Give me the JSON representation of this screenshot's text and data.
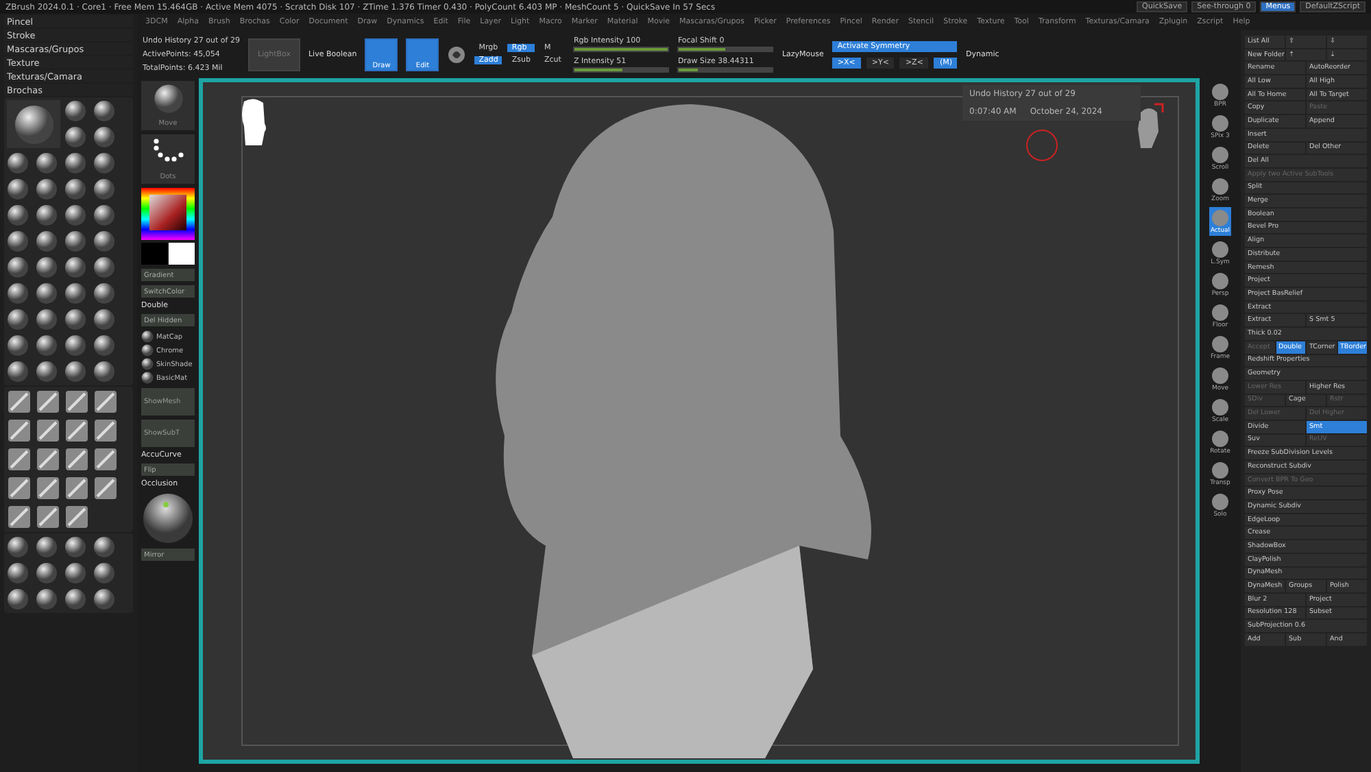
{
  "title_bar": {
    "text": "ZBrush 2024.0.1 · Core1 · Free Mem 15.464GB · Active Mem 4075 · Scratch Disk 107 · ZTime 1.376 Timer 0.430 · PolyCount 6.403 MP · MeshCount 5 · QuickSave In 57 Secs",
    "buttons": [
      {
        "label": "QuickSave",
        "selected": false
      },
      {
        "label": "See-through 0",
        "selected": false
      },
      {
        "label": "Menus",
        "selected": true
      },
      {
        "label": "DefaultZScript",
        "selected": false
      }
    ]
  },
  "palettes": [
    {
      "label": "Pincel"
    },
    {
      "label": "Stroke"
    },
    {
      "label": "Mascaras/Grupos"
    },
    {
      "label": "Texture"
    },
    {
      "label": "Texturas/Camara"
    },
    {
      "label": "Brochas"
    }
  ],
  "menu_bar": [
    "3DCM",
    "Alpha",
    "Brush",
    "Brochas",
    "Color",
    "Document",
    "Draw",
    "Dynamics",
    "Edit",
    "File",
    "Layer",
    "Light",
    "Macro",
    "Marker",
    "Material",
    "Movie",
    "Mascaras/Grupos",
    "Picker",
    "Preferences",
    "Pincel",
    "Render",
    "Stencil",
    "Stroke",
    "Texture",
    "Tool",
    "Transform",
    "Texturas/Camara",
    "Zplugin",
    "Zscript",
    "Help"
  ],
  "shelf": {
    "undo": "Undo History 27 out of 29",
    "active_points": "ActivePoints: 45,054",
    "total_points": "TotalPoints: 6.423 Mil",
    "toggles": [
      {
        "label": "LightBox",
        "selected": false
      },
      {
        "label": "Live Boolean",
        "selected": false
      }
    ],
    "tools": [
      {
        "label": "Draw",
        "selected": true
      },
      {
        "label": "Edit",
        "selected": true
      }
    ],
    "modes": [
      {
        "label": "Mrgb",
        "selected": false
      },
      {
        "label": "Rgb",
        "selected": true
      },
      {
        "label": "M",
        "selected": false
      },
      {
        "label": "Zadd",
        "selected": true
      },
      {
        "label": "Zsub",
        "selected": false
      },
      {
        "label": "Zcut",
        "selected": false
      }
    ],
    "sliders": [
      {
        "label": "Rgb Intensity 100",
        "level": 1
      },
      {
        "label": "Z Intensity 51",
        "level": 0.51
      },
      {
        "label": "Focal Shift 0",
        "level": 0.5
      },
      {
        "label": "Draw Size 38.44311",
        "level": 0.2
      }
    ],
    "lazymouse": "LazyMouse",
    "symmetry": {
      "label": "Activate Symmetry",
      "selected": true
    },
    "axes": [
      {
        "label": ">X<",
        "selected": true
      },
      {
        "label": ">Y<",
        "selected": false
      },
      {
        "label": ">Z<",
        "selected": false
      },
      {
        "label": "(M)",
        "selected": true
      }
    ],
    "dynamic": "Dynamic"
  },
  "side_column": [
    {
      "kind": "thumb",
      "label": "Move"
    },
    {
      "kind": "stroke",
      "label": "Dots"
    },
    {
      "kind": "colorpicker"
    },
    {
      "kind": "button",
      "label": "Gradient"
    },
    {
      "kind": "button",
      "label": "SwitchColor"
    },
    {
      "kind": "label",
      "label": "Double"
    },
    {
      "kind": "button",
      "label": "Del Hidden"
    },
    {
      "kind": "materials",
      "labels": [
        "MatCap",
        "Chrome",
        "SkinShade",
        "BasicMat"
      ]
    },
    {
      "kind": "tall",
      "label": "ShowMesh"
    },
    {
      "kind": "tall",
      "label": "ShowSubT"
    },
    {
      "kind": "label",
      "label": "AccuCurve"
    },
    {
      "kind": "button",
      "label": "Flip"
    },
    {
      "kind": "label",
      "label": "Occlusion"
    },
    {
      "kind": "sphere"
    },
    {
      "kind": "button",
      "label": "Mirror"
    }
  ],
  "viewport": {
    "tooltip": {
      "title": "Undo History 27 out of 29",
      "time": "0:07:40 AM",
      "date": "October 24, 2024"
    }
  },
  "right_shelf": [
    {
      "label": "BPR",
      "selected": false
    },
    {
      "label": "SPix 3",
      "selected": false
    },
    {
      "label": "Scroll",
      "selected": false
    },
    {
      "label": "Zoom",
      "selected": false
    },
    {
      "label": "Actual",
      "selected": true
    },
    {
      "label": "L.Sym",
      "selected": false
    },
    {
      "label": "Persp",
      "selected": false
    },
    {
      "label": "Floor",
      "selected": false
    },
    {
      "label": "Frame",
      "selected": false
    },
    {
      "label": "Move",
      "selected": false
    },
    {
      "label": "Scale",
      "selected": false
    },
    {
      "label": "Rotate",
      "selected": false
    },
    {
      "label": "Transp",
      "selected": false
    },
    {
      "label": "Solo",
      "selected": false
    }
  ],
  "right_panel": [
    [
      {
        "label": "List All",
        "selected": false,
        "disabled": false
      },
      {
        "label": "⇧",
        "selected": false,
        "disabled": false
      },
      {
        "label": "⇩",
        "selected": false,
        "disabled": false
      }
    ],
    [
      {
        "label": "New Folder",
        "selected": false,
        "disabled": false
      },
      {
        "label": "⇡",
        "selected": false,
        "disabled": false
      },
      {
        "label": "⇣",
        "selected": false,
        "disabled": false
      }
    ],
    [
      {
        "label": "Rename",
        "selected": false,
        "disabled": false
      },
      {
        "label": "AutoReorder",
        "selected": false,
        "disabled": false
      }
    ],
    [
      {
        "label": "All Low",
        "selected": false,
        "disabled": false
      },
      {
        "label": "All High",
        "selected": false,
        "disabled": false
      }
    ],
    [
      {
        "label": "All To Home",
        "selected": false,
        "disabled": false
      },
      {
        "label": "All To Target",
        "selected": false,
        "disabled": false
      }
    ],
    [
      {
        "label": "Copy",
        "selected": false,
        "disabled": false
      },
      {
        "label": "Paste",
        "selected": false,
        "disabled": true
      }
    ],
    [
      {
        "label": "Duplicate",
        "selected": false,
        "disabled": false
      },
      {
        "label": "Append",
        "selected": false,
        "disabled": false
      }
    ],
    [
      {
        "label": "Insert",
        "selected": false,
        "disabled": false
      }
    ],
    [
      {
        "label": "Delete",
        "selected": false,
        "disabled": false
      },
      {
        "label": "Del Other",
        "selected": false,
        "disabled": false
      }
    ],
    [
      {
        "label": "Del All",
        "selected": false,
        "disabled": false
      }
    ],
    [
      {
        "label": "Apply two Active SubTools",
        "selected": false,
        "disabled": true
      }
    ],
    [
      {
        "label": "Split",
        "selected": false,
        "disabled": false
      }
    ],
    [
      {
        "label": "Merge",
        "selected": false,
        "disabled": false
      }
    ],
    [
      {
        "label": "Boolean",
        "selected": false,
        "disabled": false
      }
    ],
    [
      {
        "label": "Bevel Pro",
        "selected": false,
        "disabled": false
      }
    ],
    [
      {
        "label": "Align",
        "selected": false,
        "disabled": false
      }
    ],
    [
      {
        "label": "Distribute",
        "selected": false,
        "disabled": false
      }
    ],
    [
      {
        "label": "Remesh",
        "selected": false,
        "disabled": false
      }
    ],
    [
      {
        "label": "Project",
        "selected": false,
        "disabled": false
      }
    ],
    [
      {
        "label": "Project BasRelief",
        "selected": false,
        "disabled": false
      }
    ],
    [
      {
        "label": "Extract",
        "selected": false,
        "disabled": false
      }
    ],
    [
      {
        "label": "Extract",
        "selected": false,
        "disabled": false
      },
      {
        "label": "S Smt 5",
        "selected": false,
        "disabled": false
      }
    ],
    [
      {
        "label": "Thick 0.02",
        "selected": false,
        "disabled": false
      }
    ],
    [
      {
        "label": "Accept",
        "selected": false,
        "disabled": true
      },
      {
        "label": "Double",
        "selected": true,
        "disabled": false
      },
      {
        "label": "TCorner",
        "selected": false,
        "disabled": false
      },
      {
        "label": "TBorder",
        "selected": true,
        "disabled": false
      }
    ],
    [
      {
        "label": "Redshift Properties",
        "selected": false,
        "disabled": false
      }
    ],
    [
      {
        "label": "Geometry",
        "selected": false,
        "disabled": false
      }
    ],
    [
      {
        "label": "Lower Res",
        "selected": false,
        "disabled": true
      },
      {
        "label": "Higher Res",
        "selected": false,
        "disabled": false
      }
    ],
    [
      {
        "label": "SDiv",
        "selected": false,
        "disabled": true
      },
      {
        "label": "Cage",
        "selected": false,
        "disabled": false
      },
      {
        "label": "Rstr",
        "selected": false,
        "disabled": true
      }
    ],
    [
      {
        "label": "Del Lower",
        "selected": false,
        "disabled": true
      },
      {
        "label": "Del Higher",
        "selected": false,
        "disabled": true
      }
    ],
    [
      {
        "label": "Divide",
        "selected": false,
        "disabled": false
      },
      {
        "label": "Smt",
        "selected": true,
        "disabled": false
      }
    ],
    [
      {
        "label": "Suv",
        "selected": false,
        "disabled": false
      },
      {
        "label": "ReUV",
        "selected": false,
        "disabled": true
      }
    ],
    [
      {
        "label": "Freeze SubDivision Levels",
        "selected": false,
        "disabled": false
      }
    ],
    [
      {
        "label": "Reconstruct Subdiv",
        "selected": false,
        "disabled": false
      }
    ],
    [
      {
        "label": "Convert BPR To Geo",
        "selected": false,
        "disabled": true
      }
    ],
    [
      {
        "label": "Proxy Pose",
        "selected": false,
        "disabled": false
      }
    ],
    [
      {
        "label": "Dynamic Subdiv",
        "selected": false,
        "disabled": false
      }
    ],
    [
      {
        "label": "EdgeLoop",
        "selected": false,
        "disabled": false
      }
    ],
    [
      {
        "label": "Crease",
        "selected": false,
        "disabled": false
      }
    ],
    [
      {
        "label": "ShadowBox",
        "selected": false,
        "disabled": false
      }
    ],
    [
      {
        "label": "ClayPolish",
        "selected": false,
        "disabled": false
      }
    ],
    [
      {
        "label": "DynaMesh",
        "selected": false,
        "disabled": false
      }
    ],
    [
      {
        "label": "DynaMesh",
        "selected": false,
        "disabled": false
      },
      {
        "label": "Groups",
        "selected": false,
        "disabled": false
      },
      {
        "label": "Polish",
        "selected": false,
        "disabled": false
      }
    ],
    [
      {
        "label": "Blur 2",
        "selected": false,
        "disabled": false
      },
      {
        "label": "Project",
        "selected": false,
        "disabled": false
      }
    ],
    [
      {
        "label": "Resolution 128",
        "selected": false,
        "disabled": false
      },
      {
        "label": "Subset",
        "selected": false,
        "disabled": false
      }
    ],
    [
      {
        "label": "SubProjection 0.6",
        "selected": false,
        "disabled": false
      }
    ],
    [
      {
        "label": "Add",
        "selected": false,
        "disabled": false
      },
      {
        "label": "Sub",
        "selected": false,
        "disabled": false
      },
      {
        "label": "And",
        "selected": false,
        "disabled": false
      }
    ]
  ]
}
